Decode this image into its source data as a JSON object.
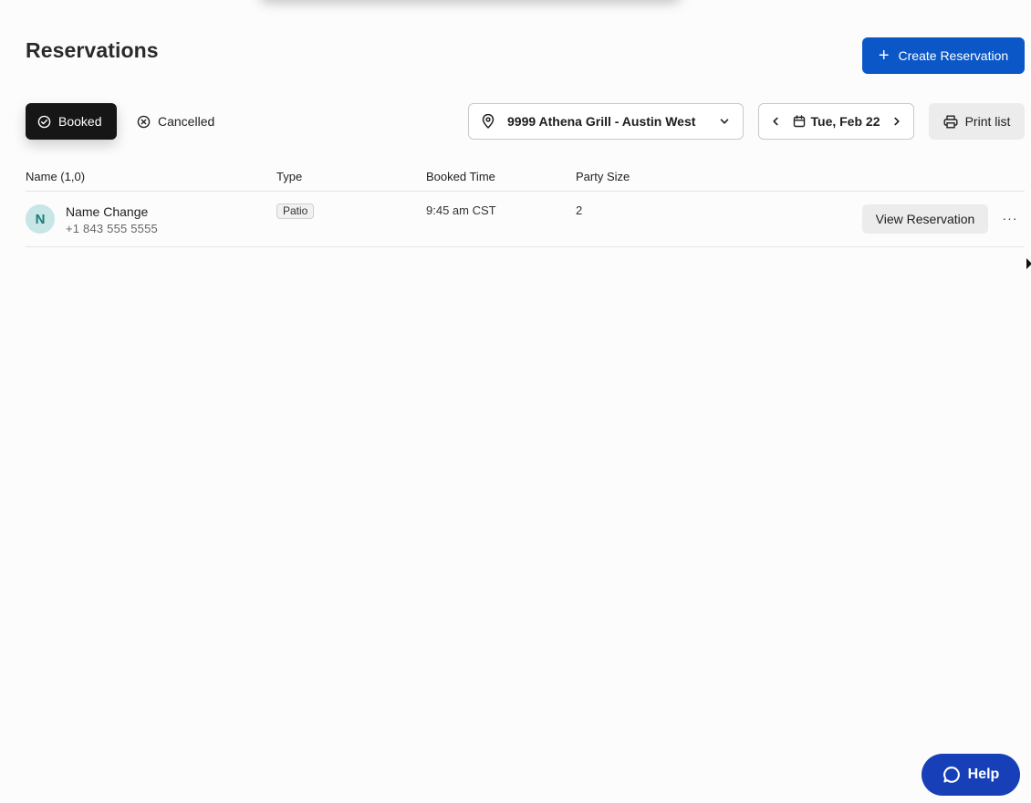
{
  "header": {
    "title": "Reservations",
    "create_label": "Create Reservation"
  },
  "filters": {
    "booked_label": "Booked",
    "cancelled_label": "Cancelled",
    "location": "9999 Athena Grill - Austin West",
    "date": "Tue, Feb 22",
    "print_label": "Print list"
  },
  "table": {
    "columns": [
      "Name (1,0)",
      "Type",
      "Booked Time",
      "Party Size"
    ],
    "rows": [
      {
        "initial": "N",
        "name": "Name Change",
        "phone": "+1 843 555 5555",
        "type": "Patio",
        "booked_time": "9:45 am CST",
        "party_size": "2",
        "action_label": "View Reservation",
        "more_label": "···"
      }
    ]
  },
  "help": {
    "label": "Help"
  },
  "colors": {
    "primary": "#0b57c7",
    "help": "#1740b8",
    "booked_bg": "#161616",
    "avatar_bg": "#c7e6e5",
    "avatar_text": "#1d7a79"
  }
}
